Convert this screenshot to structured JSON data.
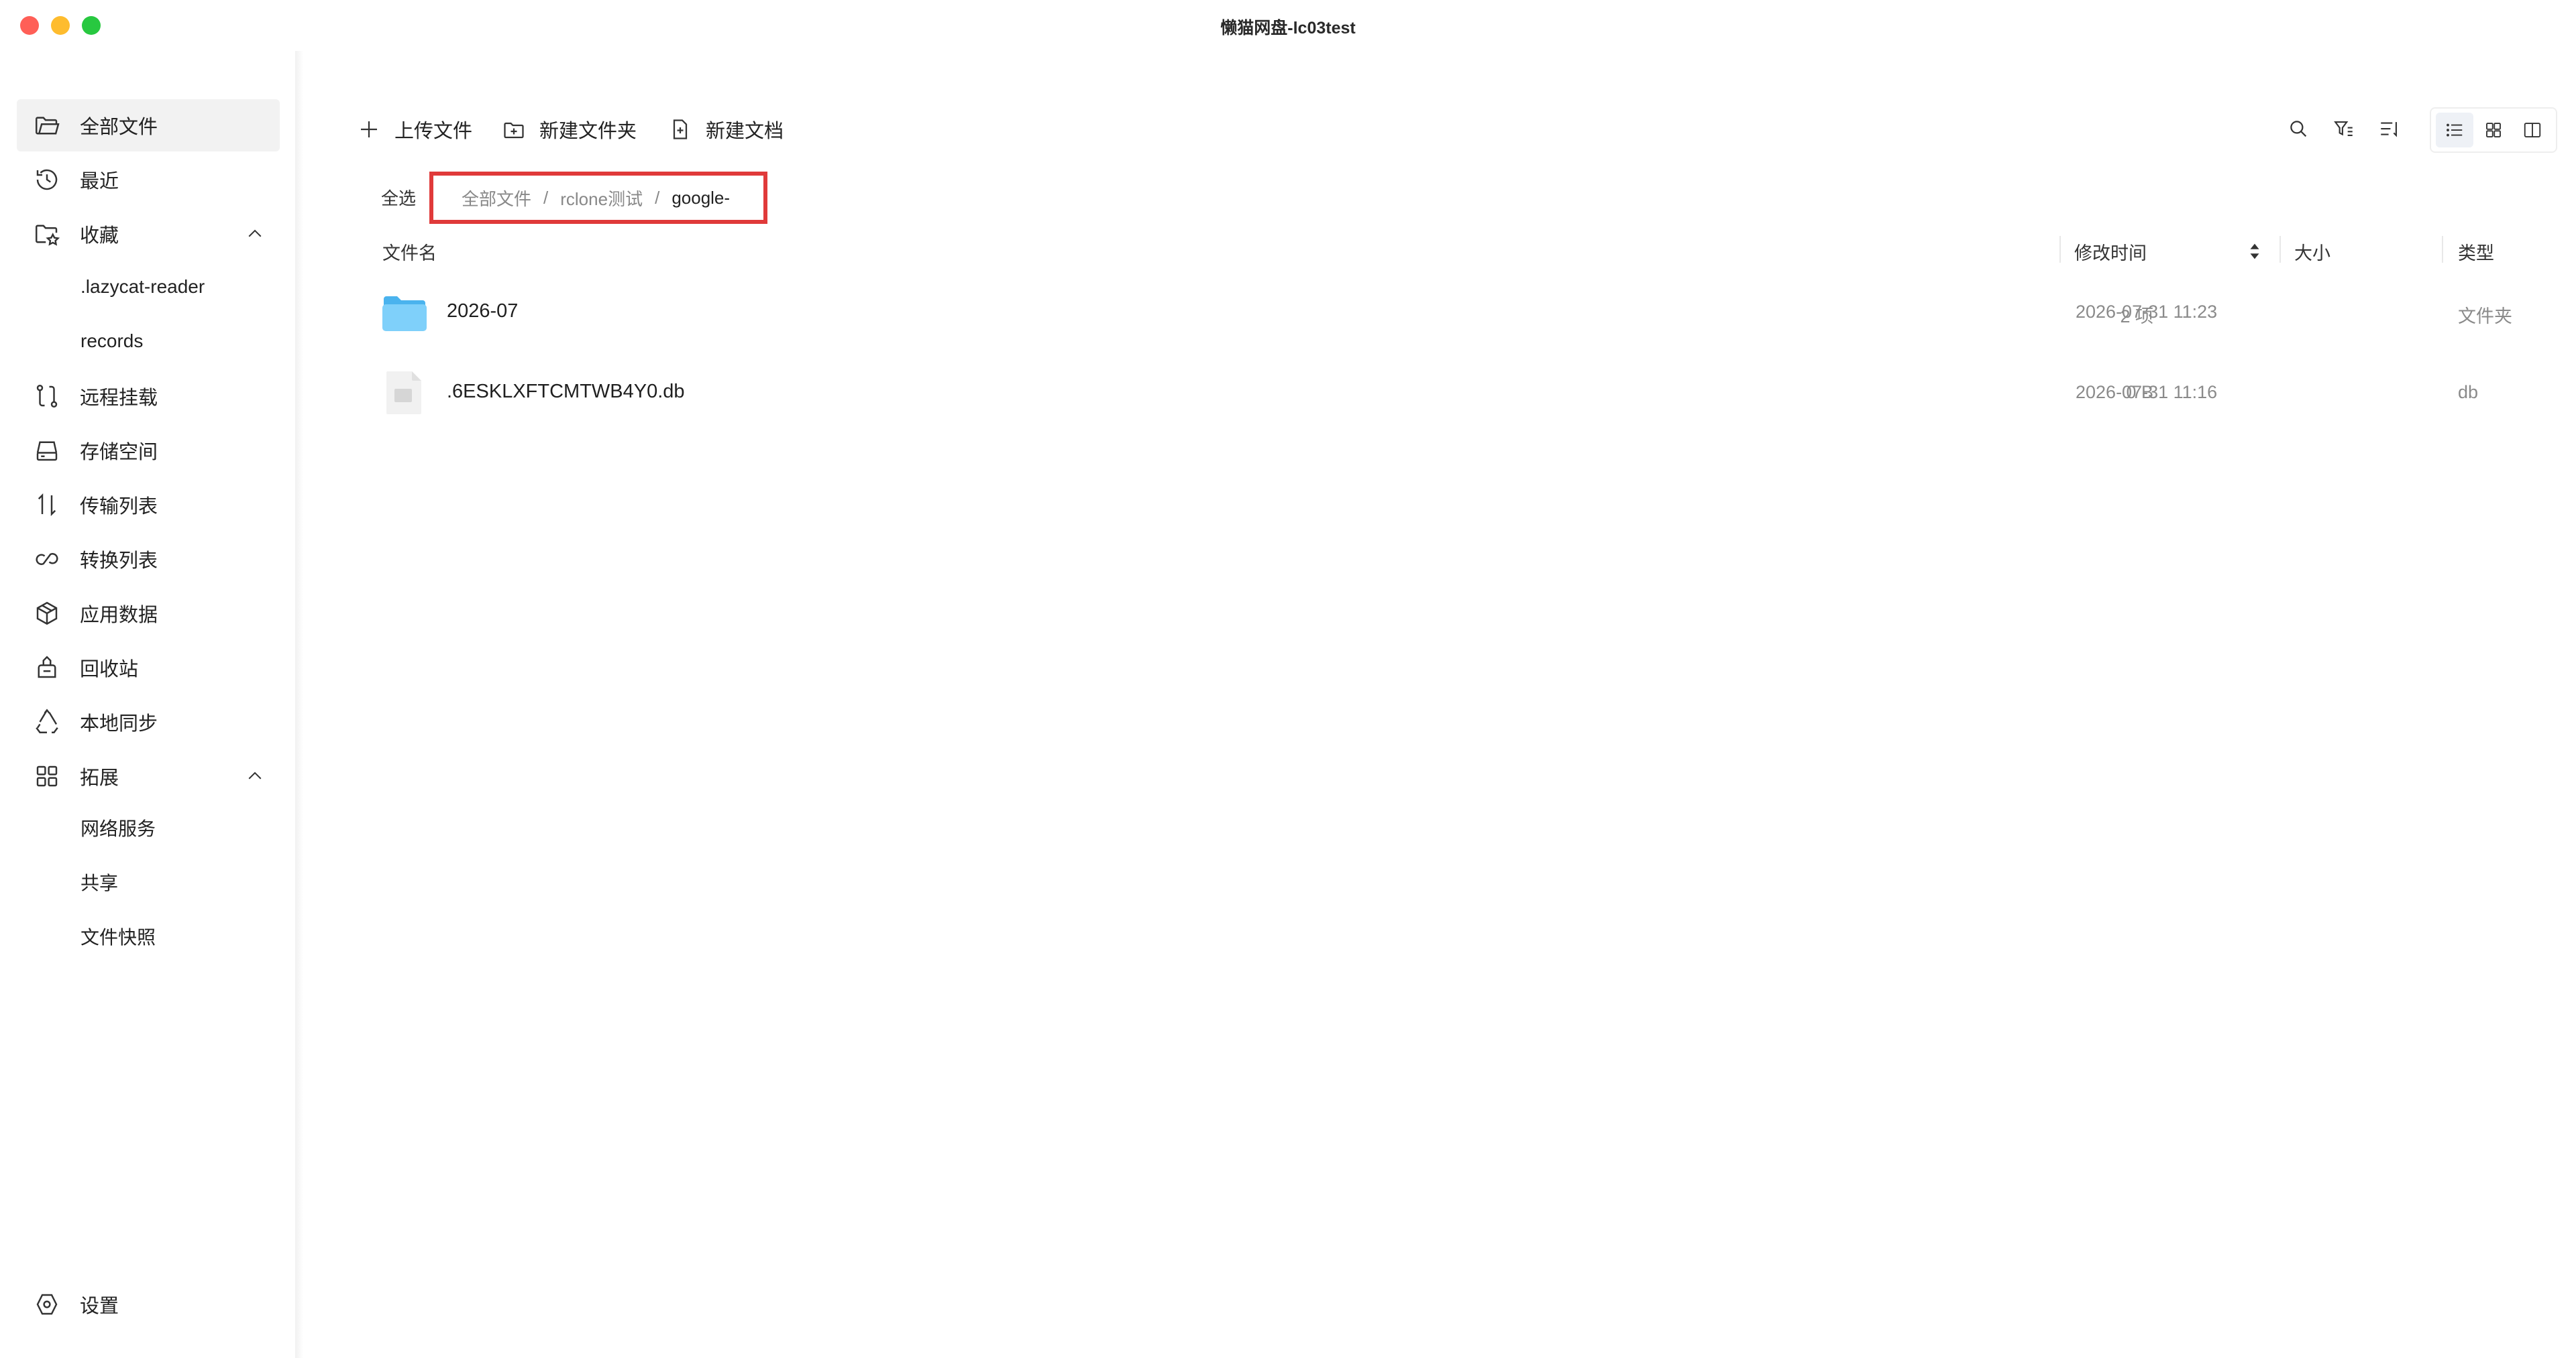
{
  "window": {
    "title": "懒猫网盘-lc03test"
  },
  "sidebar": {
    "items": [
      {
        "label": "全部文件",
        "icon": "folder-open-icon",
        "active": true
      },
      {
        "label": "最近",
        "icon": "history-icon"
      },
      {
        "label": "收藏",
        "icon": "favorite-folder-icon",
        "expanded": true
      },
      {
        "label": "远程挂载",
        "icon": "remote-mount-icon"
      },
      {
        "label": "存储空间",
        "icon": "storage-drive-icon"
      },
      {
        "label": "传输列表",
        "icon": "transfer-arrows-icon"
      },
      {
        "label": "转换列表",
        "icon": "convert-loop-icon"
      },
      {
        "label": "应用数据",
        "icon": "app-data-cube-icon"
      },
      {
        "label": "回收站",
        "icon": "recycle-bin-icon"
      },
      {
        "label": "本地同步",
        "icon": "sync-recycle-icon"
      },
      {
        "label": "拓展",
        "icon": "extensions-grid-icon",
        "expanded": true
      },
      {
        "label": "设置",
        "icon": "settings-hexagon-icon"
      }
    ],
    "favorites": [
      ".lazycat-reader",
      "records"
    ],
    "extensions": [
      "网络服务",
      "共享",
      "文件快照"
    ]
  },
  "toolbar": {
    "upload_label": "上传文件",
    "new_folder_label": "新建文件夹",
    "new_doc_label": "新建文档",
    "right_icons": [
      "search-icon",
      "filter-icon",
      "sort-list-icon"
    ],
    "view_modes": [
      "list-view-icon",
      "grid-view-icon",
      "split-view-icon"
    ],
    "active_view": "list"
  },
  "breadcrumb": {
    "select_all": "全选",
    "parts": [
      "全部文件",
      "rclone测试"
    ],
    "current": "google-",
    "separator": "/"
  },
  "table": {
    "headers": {
      "name": "文件名",
      "modified": "修改时间",
      "size": "大小",
      "type": "类型"
    },
    "rows": [
      {
        "name": "2026-07",
        "modified": "2026-07-31 11:23",
        "size": "2 项",
        "type": "文件夹",
        "kind": "folder"
      },
      {
        "name": ".6ESKLXFTCMTWB4Y0.db",
        "modified": "2026-07-31 11:16",
        "size": "0 B",
        "type": "db",
        "kind": "file"
      }
    ]
  },
  "colors": {
    "highlight_border": "#e03a3a",
    "folder_blue": "#6cc4f6",
    "active_nav_bg": "#f2f2f2"
  }
}
